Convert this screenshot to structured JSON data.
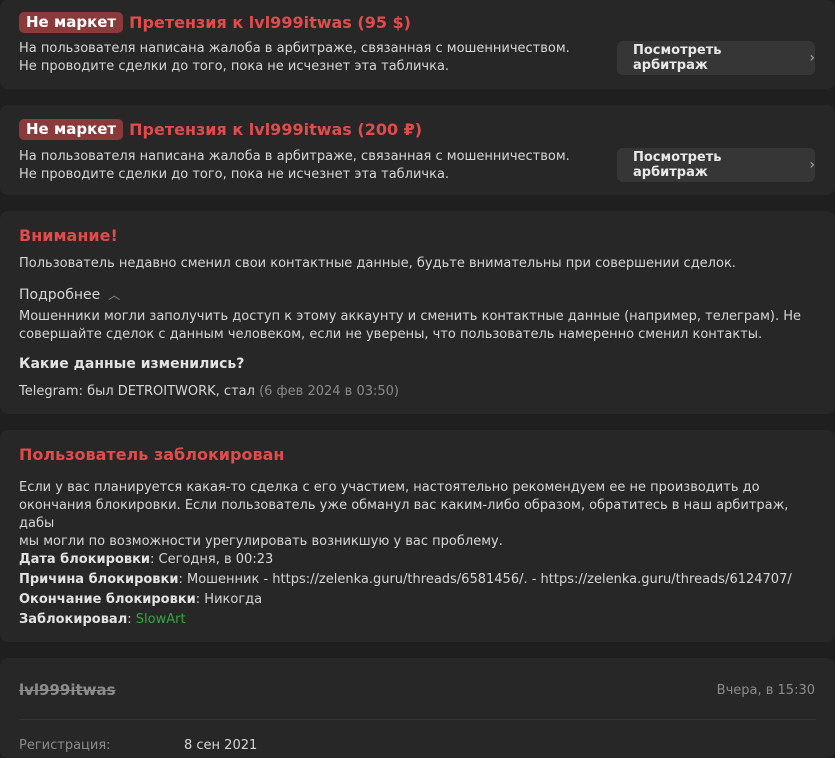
{
  "claims": [
    {
      "badge": "Не маркет",
      "title": "Претензия к lvl999itwas (95 $)",
      "line1": "На пользователя написана жалоба в арбитраже, связанная с мошенничеством.",
      "line2": "Не проводите сделки до того, пока не исчезнет эта табличка.",
      "button": "Посмотреть арбитраж"
    },
    {
      "badge": "Не маркет",
      "title": "Претензия к lvl999itwas (200 ₽)",
      "line1": "На пользователя написана жалоба в арбитраже, связанная с мошенничеством.",
      "line2": "Не проводите сделки до того, пока не исчезнет эта табличка.",
      "button": "Посмотреть арбитраж"
    }
  ],
  "warning": {
    "title": "Внимание!",
    "text": "Пользователь недавно сменил свои контактные данные, будьте внимательны при совершении сделок.",
    "more_label": "Подробнее",
    "more_line1": "Мошенники могли заполучить доступ к этому аккаунту и сменить контактные данные (например, телеграм). Не",
    "more_line2": "совершайте сделок с данным человеком, если не уверены, что пользователь намеренно сменил контакты.",
    "changed_title": "Какие данные изменились?",
    "changed_text": "Telegram: был DETROITWORK, стал",
    "changed_date": "(6 фев 2024 в 03:50)"
  },
  "ban": {
    "title": "Пользователь заблокирован",
    "line1": "Если у вас планируется какая-то сделка с его участием, настоятельно рекомендуем ее не производить до",
    "line2": "окончания блокировки. Если пользователь уже обманул вас каким-либо образом, обратитесь в наш арбитраж, дабы",
    "line3": "мы могли по возможности урегулировать возникшую у вас проблему.",
    "date_label": "Дата блокировки",
    "date_value": ": Сегодня, в 00:23",
    "reason_label": "Причина блокировки",
    "reason_value": ": Мошенник - https://zelenka.guru/threads/6581456/. - https://zelenka.guru/threads/6124707/",
    "end_label": "Окончание блокировки",
    "end_value": ": Никогда",
    "by_label": "Заблокировал",
    "by_sep": ": ",
    "by_value": "SlowArt"
  },
  "profile": {
    "username": "lvl999itwas",
    "last_seen": "Вчера, в 15:30",
    "reg_label": "Регистрация:",
    "reg_value": "8 сен 2021"
  },
  "colors": {
    "background": "#1f1f1f",
    "card": "#272727",
    "accent_red": "#e24b4b",
    "badge": "#8a3a3a",
    "green": "#2fa83f"
  }
}
